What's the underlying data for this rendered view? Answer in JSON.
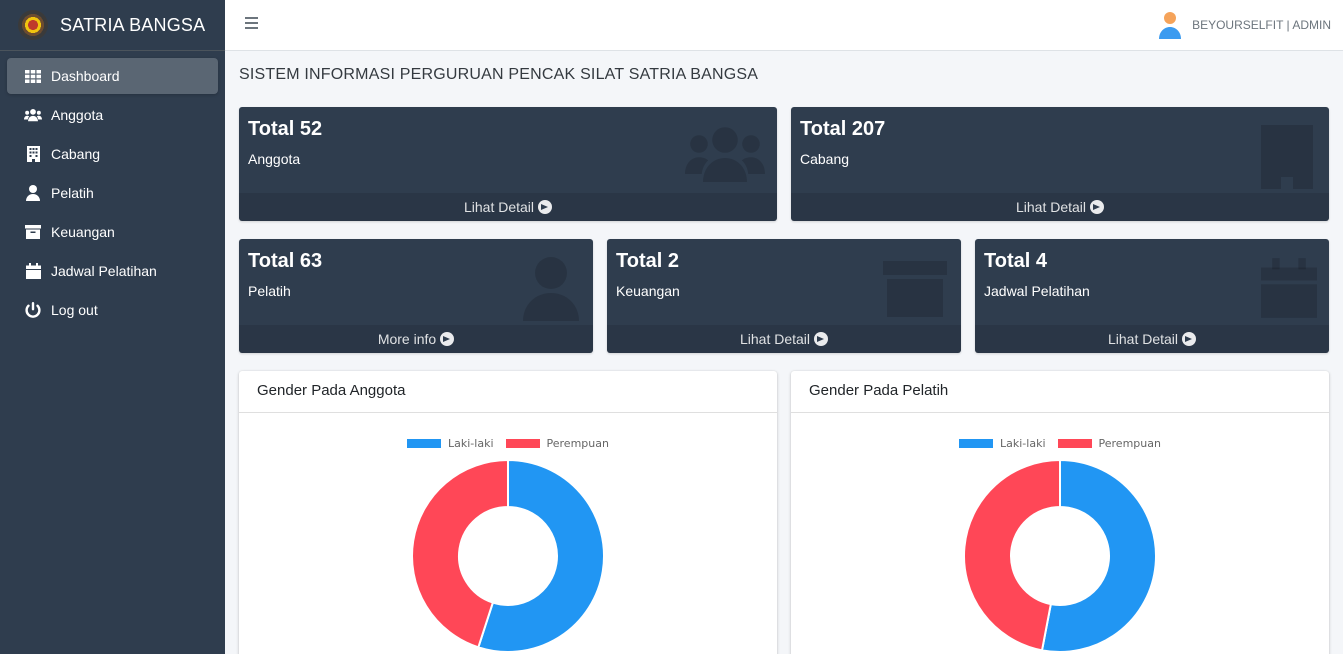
{
  "app": {
    "brand": "SATRIA BANGSA"
  },
  "sidebar": {
    "items": [
      {
        "label": "Dashboard",
        "icon": "th-icon",
        "active": true
      },
      {
        "label": "Anggota",
        "icon": "users-icon"
      },
      {
        "label": "Cabang",
        "icon": "building-icon"
      },
      {
        "label": "Pelatih",
        "icon": "user-icon"
      },
      {
        "label": "Keuangan",
        "icon": "archive-icon"
      },
      {
        "label": "Jadwal Pelatihan",
        "icon": "calendar-icon"
      },
      {
        "label": "Log out",
        "icon": "power-icon"
      }
    ]
  },
  "header": {
    "user": "BEYOURSELFIT | ADMIN"
  },
  "page": {
    "title": "SISTEM INFORMASI PERGURUAN PENCAK SILAT SATRIA BANGSA"
  },
  "stats": [
    {
      "total": "Total 52",
      "label": "Anggota",
      "link": "Lihat Detail",
      "icon": "users-icon"
    },
    {
      "total": "Total 207",
      "label": "Cabang",
      "link": "Lihat Detail",
      "icon": "building-icon"
    },
    {
      "total": "Total 63",
      "label": "Pelatih",
      "link": "More info",
      "icon": "user-icon"
    },
    {
      "total": "Total 2",
      "label": "Keuangan",
      "link": "Lihat Detail",
      "icon": "archive-icon"
    },
    {
      "total": "Total 4",
      "label": "Jadwal Pelatihan",
      "link": "Lihat Detail",
      "icon": "calendar-icon"
    }
  ],
  "charts": {
    "anggota": {
      "title": "Gender Pada Anggota"
    },
    "pelatih": {
      "title": "Gender Pada Pelatih"
    }
  },
  "colors": {
    "laki": "#2196F3",
    "perempuan": "#FF4757",
    "sidebar": "#2f3d4e"
  },
  "chart_data": [
    {
      "type": "pie",
      "variant": "doughnut",
      "title": "Gender Pada Anggota",
      "categories": [
        "Laki-laki",
        "Perempuan"
      ],
      "values": [
        55,
        45
      ],
      "legend": "top"
    },
    {
      "type": "pie",
      "variant": "doughnut",
      "title": "Gender Pada Pelatih",
      "categories": [
        "Laki-laki",
        "Perempuan"
      ],
      "values": [
        53,
        47
      ],
      "legend": "top"
    }
  ]
}
